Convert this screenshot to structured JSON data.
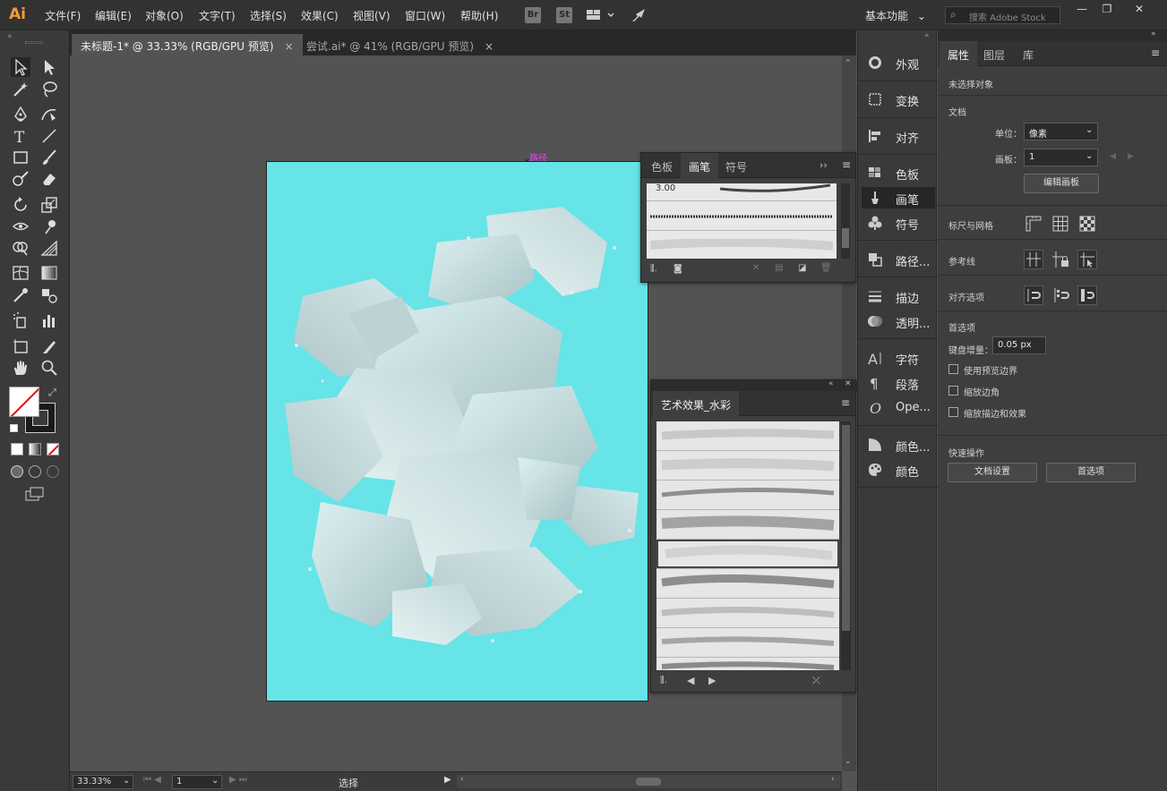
{
  "app": {
    "logo": "Ai"
  },
  "menu": [
    "文件(F)",
    "编辑(E)",
    "对象(O)",
    "文字(T)",
    "选择(S)",
    "效果(C)",
    "视图(V)",
    "窗口(W)",
    "帮助(H)"
  ],
  "menu_chips": [
    "Br",
    "St"
  ],
  "workspace": "基本功能",
  "search": {
    "placeholder": "搜索 Adobe Stock"
  },
  "window_controls": {
    "minimize": "—",
    "restore": "❐",
    "close": "✕"
  },
  "tabs": [
    {
      "label": "未标题-1* @ 33.33% (RGB/GPU 预览)",
      "close": "×"
    },
    {
      "label": "尝试.ai* @ 41% (RGB/GPU 预览)",
      "close": "×"
    }
  ],
  "canvas": {
    "path_label": "路径"
  },
  "brush_panel": {
    "tabs": [
      "色板",
      "画笔",
      "符号"
    ],
    "more": "››",
    "size_label": "3.00"
  },
  "watercolor_panel": {
    "title": "艺术效果_水彩"
  },
  "dock": {
    "items": [
      "外观",
      "变换",
      "对齐",
      "色板",
      "画笔",
      "符号",
      "路径...",
      "描边",
      "透明...",
      "字符",
      "段落",
      "Ope...",
      "颜色...",
      "颜色"
    ]
  },
  "properties": {
    "tabs": [
      "属性",
      "图层",
      "库"
    ],
    "no_selection": "未选择对象",
    "document_section": "文档",
    "unit_label": "单位：",
    "unit_value": "像素",
    "artboard_label": "画板：",
    "artboard_value": "1",
    "edit_artboard_button": "编辑画板",
    "rulers_grid": "标尺与网格",
    "guides": "参考线",
    "snap_options": "对齐选项",
    "preferences_section": "首选项",
    "keyboard_increment_label": "键盘增量：",
    "keyboard_increment_value": "0.05 px",
    "checkboxes": [
      "使用预览边界",
      "缩放边角",
      "缩放描边和效果"
    ],
    "quick_actions": "快速操作",
    "doc_setup_button": "文档设置",
    "prefs_button": "首选项"
  },
  "status": {
    "zoom": "33.33%",
    "artboard_num": "1",
    "tool": "选择"
  },
  "colors": {
    "artboard": "#66e4e8",
    "path_label": "#e846e8",
    "logo": "#f29a3b"
  }
}
